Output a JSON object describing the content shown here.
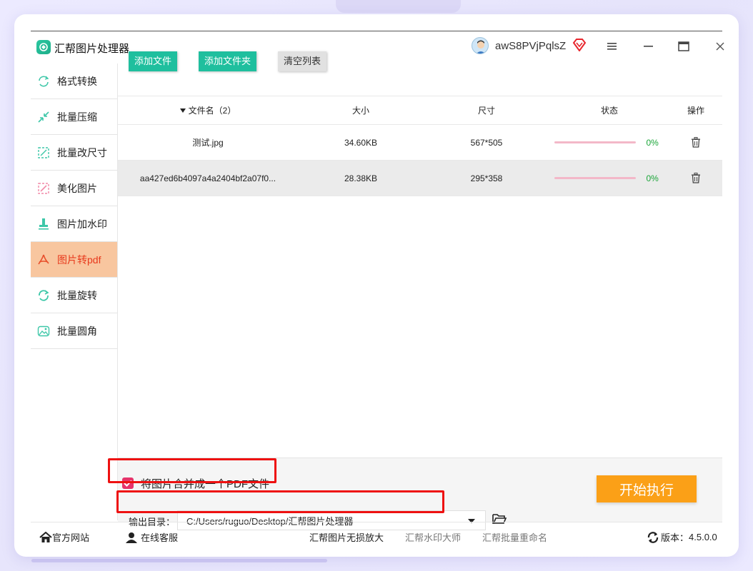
{
  "app": {
    "title": "汇帮图片处理器",
    "username": "awS8PVjPqlsZ",
    "icons": [
      "app-logo-icon",
      "avatar-icon",
      "vip-diamond-icon",
      "menu-icon",
      "minimize-icon",
      "maximize-icon",
      "close-icon"
    ]
  },
  "sidebar": {
    "items": [
      {
        "label": "格式转换",
        "icon": "format-convert-icon"
      },
      {
        "label": "批量压缩",
        "icon": "compress-icon"
      },
      {
        "label": "批量改尺寸",
        "icon": "resize-icon"
      },
      {
        "label": "美化图片",
        "icon": "beautify-icon"
      },
      {
        "label": "图片加水印",
        "icon": "watermark-icon"
      },
      {
        "label": "图片转pdf",
        "icon": "pdf-icon",
        "active": true
      },
      {
        "label": "批量旋转",
        "icon": "rotate-icon"
      },
      {
        "label": "批量圆角",
        "icon": "round-corner-icon"
      }
    ]
  },
  "toolbar": {
    "add_file": "添加文件",
    "add_folder": "添加文件夹",
    "clear_list": "清空列表"
  },
  "table": {
    "headers": {
      "name": "文件名（2）",
      "size": "大小",
      "dimension": "尺寸",
      "status": "状态",
      "action": "操作"
    },
    "rows": [
      {
        "name": "测试.jpg",
        "size": "34.60KB",
        "dimension": "567*505",
        "progress": 0,
        "progress_label": "0%"
      },
      {
        "name": "aa427ed6b4097a4a2404bf2a07f0...",
        "size": "28.38KB",
        "dimension": "295*358",
        "progress": 0,
        "progress_label": "0%"
      }
    ]
  },
  "options": {
    "merge_label": "将图片合并成一个PDF文件",
    "merge_checked": true,
    "output_label": "输出目录：",
    "output_path": "C:/Users/ruguo/Desktop/汇帮图片处理器",
    "start_button": "开始执行"
  },
  "statusbar": {
    "website": "官方网站",
    "service": "在线客服",
    "link1": "汇帮图片无损放大",
    "link2": "汇帮水印大师",
    "link3": "汇帮批量重命名",
    "version_label": "版本：",
    "version": "4.5.0.0"
  },
  "colors": {
    "accent": "#1fbf9e",
    "active_sidebar_bg": "#f8c69f",
    "active_sidebar_text": "#e8391c",
    "start_button": "#fba017",
    "checkbox": "#e6336a",
    "highlight_box": "#ee1111",
    "percent_text": "#1aa538"
  }
}
